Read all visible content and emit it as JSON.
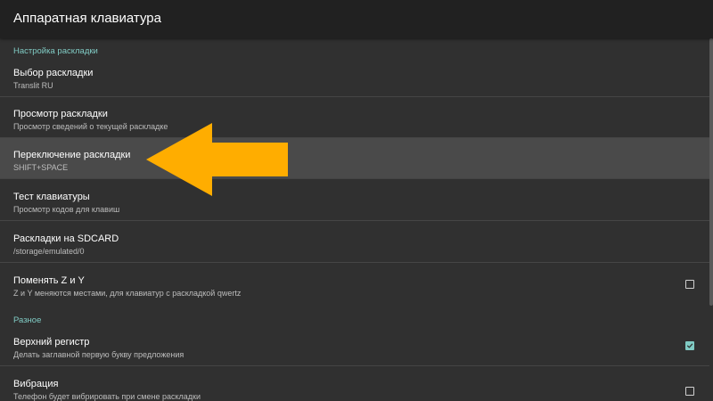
{
  "app_bar": {
    "title": "Аппаратная клавиатура"
  },
  "sections": [
    {
      "header": "Настройка раскладки",
      "items": [
        {
          "title": "Выбор раскладки",
          "summary": "Translit RU"
        },
        {
          "title": "Просмотр раскладки",
          "summary": "Просмотр сведений о текущей раскладке"
        },
        {
          "title": "Переключение раскладки",
          "summary": "SHIFT+SPACE"
        },
        {
          "title": "Тест клавиатуры",
          "summary": "Просмотр кодов для клавиш"
        },
        {
          "title": "Раскладки на SDCARD",
          "summary": "/storage/emulated/0"
        },
        {
          "title": "Поменять Z и Y",
          "summary": "Z и Y меняются местами, для клавиатур с раскладкой qwertz",
          "checkbox": false
        }
      ]
    },
    {
      "header": "Разное",
      "items": [
        {
          "title": "Верхний регистр",
          "summary": "Делать заглавной первую букву предложения",
          "checkbox": true
        },
        {
          "title": "Вибрация",
          "summary": "Телефон будет вибрировать при смене раскладки",
          "checkbox": false
        }
      ]
    }
  ],
  "focused_item": "Переключение раскладки",
  "colors": {
    "accent": "#80cbc4",
    "arrow": "#ffad00",
    "background": "#303030",
    "app_bar": "#212121"
  },
  "icons": {
    "annotation": "arrow-left-icon",
    "checked": "checkmark-icon"
  }
}
